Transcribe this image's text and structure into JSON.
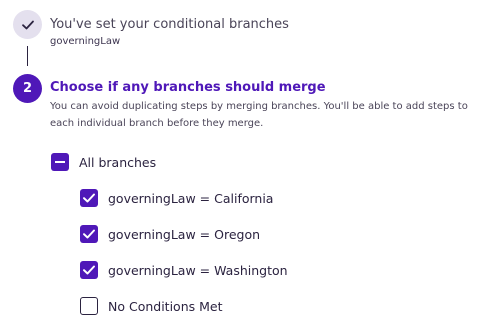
{
  "step1": {
    "icon": "check-icon",
    "title": "You've set your conditional branches",
    "subtitle": "governingLaw"
  },
  "step2": {
    "number": "2",
    "title": "Choose if any branches should merge",
    "description": "You can avoid duplicating steps by merging branches. You'll be able to add steps to each individual branch before they merge."
  },
  "branches": {
    "all": {
      "label": "All branches",
      "state": "indeterminate"
    },
    "items": [
      {
        "label": "governingLaw = California",
        "checked": true
      },
      {
        "label": "governingLaw = Oregon",
        "checked": true
      },
      {
        "label": "governingLaw = Washington",
        "checked": true
      },
      {
        "label": "No Conditions Met",
        "checked": false
      }
    ]
  },
  "colors": {
    "accent": "#4f18b8",
    "done_circle": "#e4e0ee",
    "text": "#2b2340"
  }
}
